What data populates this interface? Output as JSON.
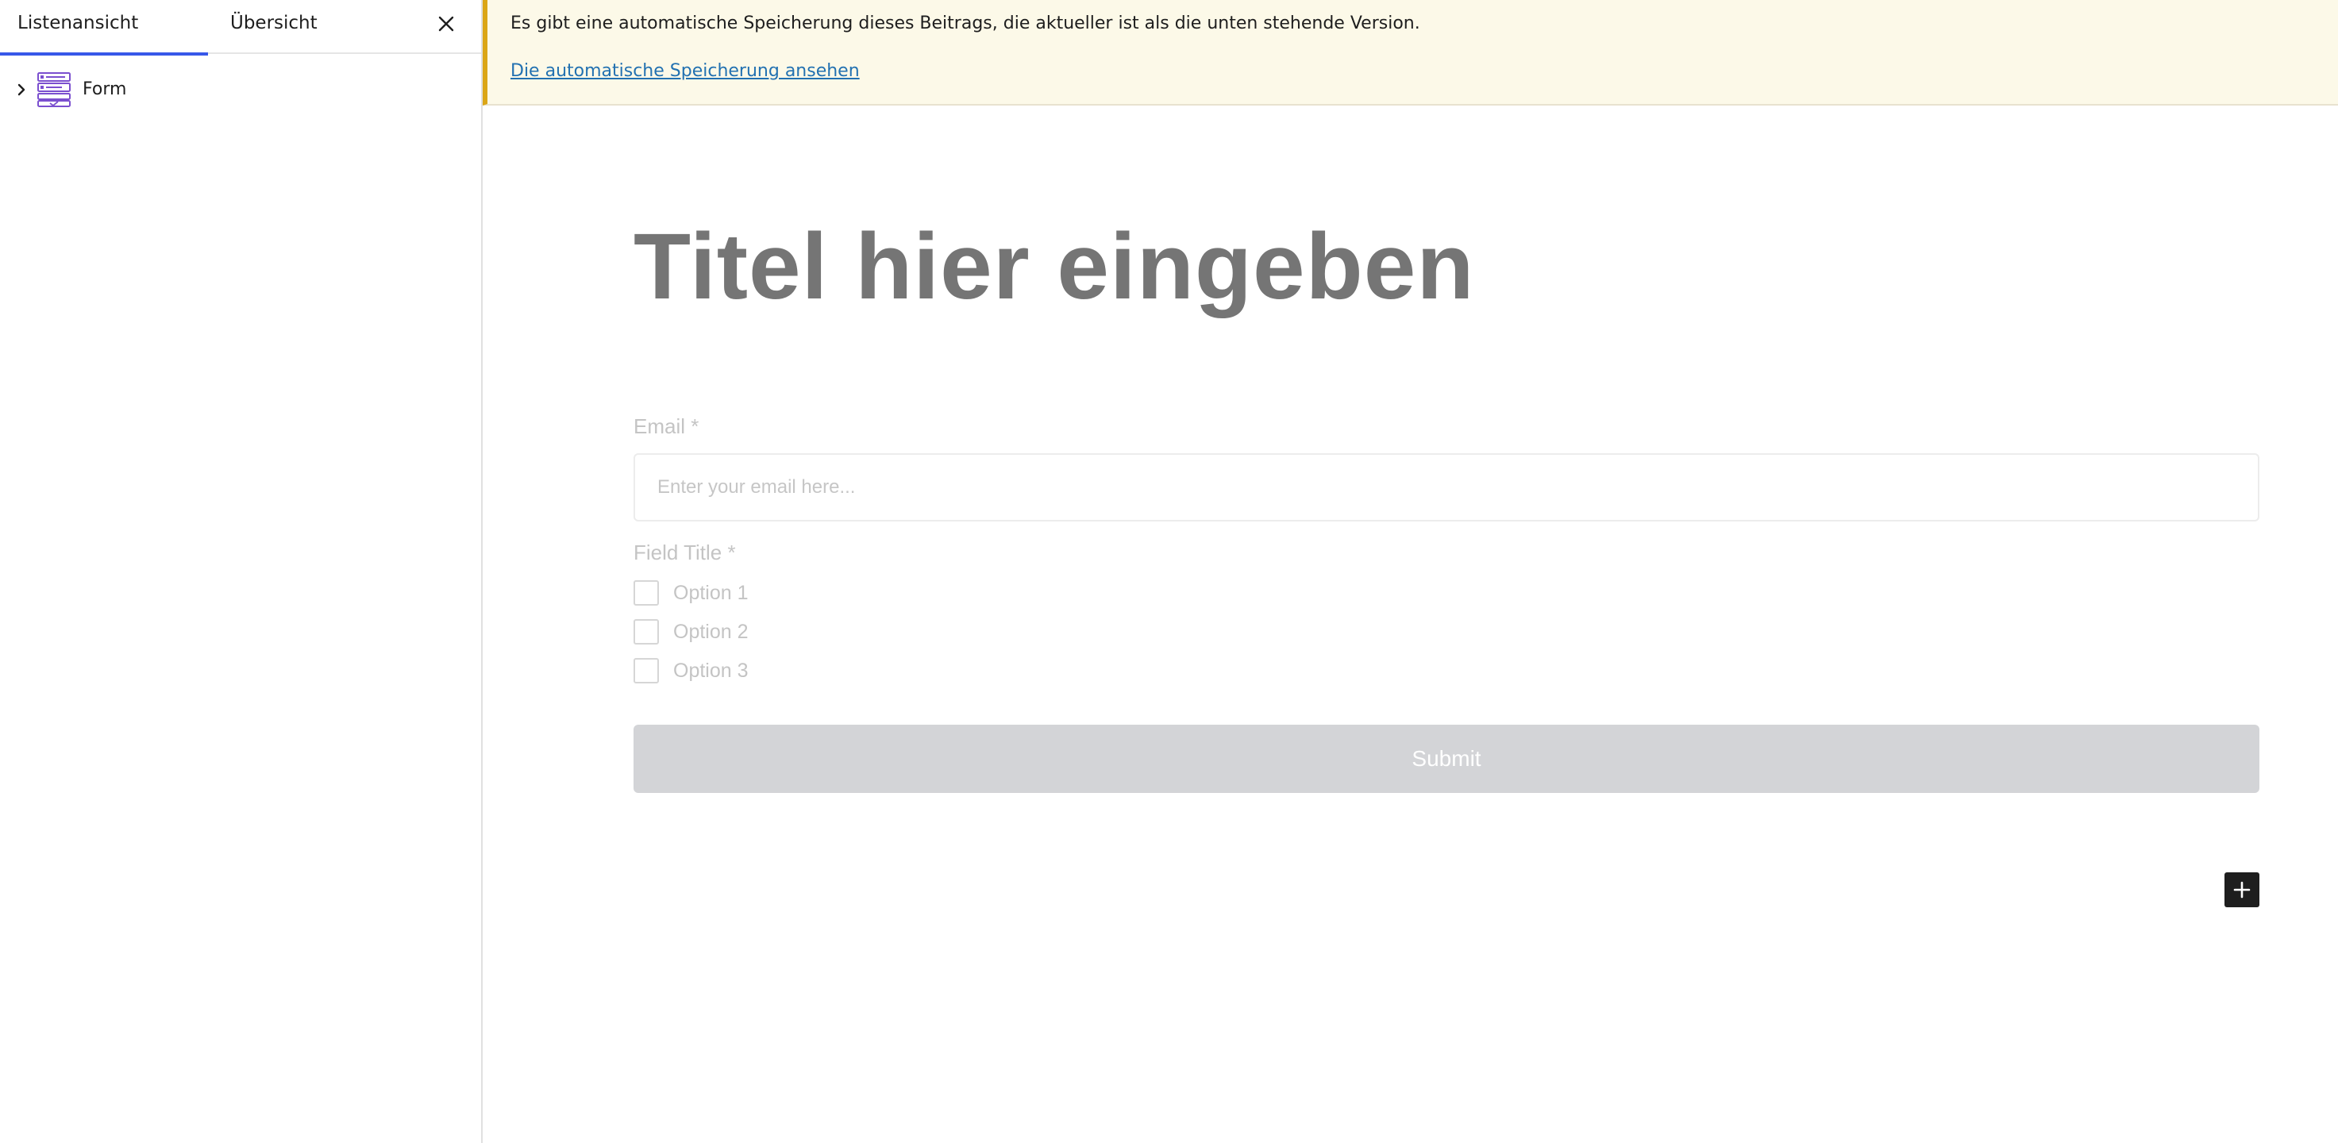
{
  "sidebar": {
    "tabs": [
      {
        "label": "Listenansicht",
        "active": true
      },
      {
        "label": "Übersicht",
        "active": false
      }
    ],
    "tree": [
      {
        "label": "Form",
        "icon": "form-block-icon",
        "expanded": false
      }
    ]
  },
  "notice": {
    "message": "Es gibt eine automatische Speicherung dieses Beitrags, die aktueller ist als die unten stehende Version.",
    "link": "Die automatische Speicherung ansehen"
  },
  "editor": {
    "title_placeholder": "Titel hier eingeben",
    "form": {
      "email_label": "Email *",
      "email_placeholder": "Enter your email here...",
      "checkbox_title": "Field Title *",
      "options": [
        "Option 1",
        "Option 2",
        "Option 3"
      ],
      "submit_label": "Submit"
    }
  },
  "colors": {
    "accent": "#3858e9",
    "notice_border": "#dba617",
    "notice_bg": "#fcf9e8",
    "link": "#2271b1",
    "submit_bg": "#d3d4d7"
  }
}
